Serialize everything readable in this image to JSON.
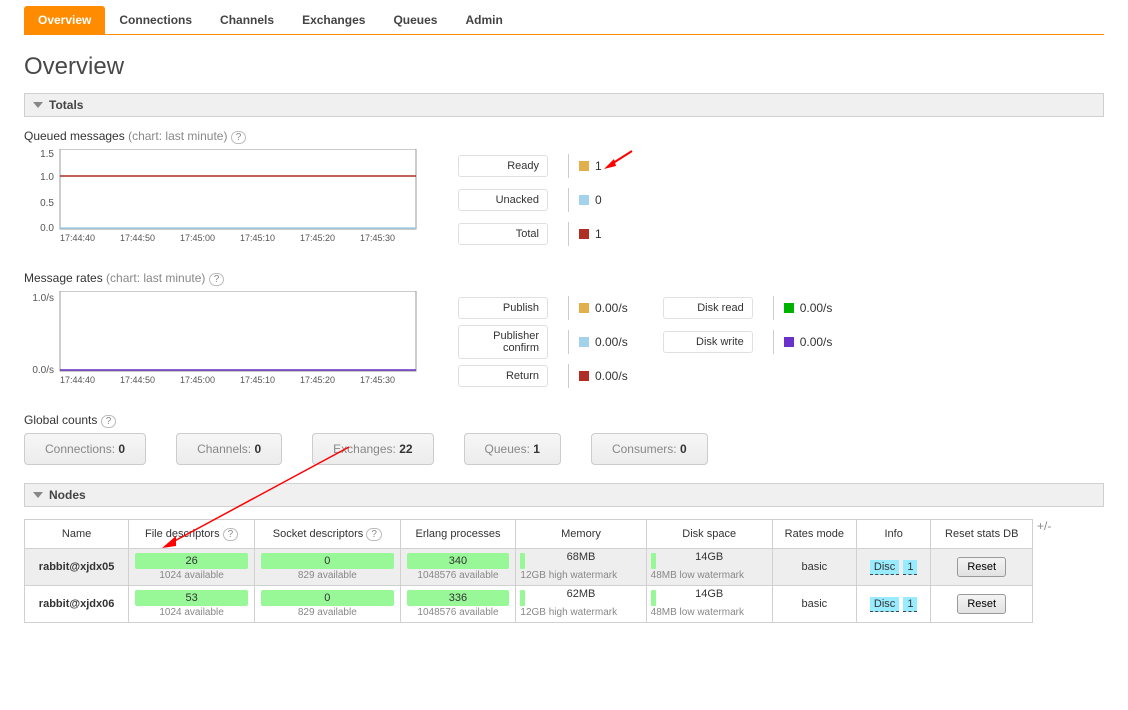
{
  "nav": {
    "tabs": [
      "Overview",
      "Connections",
      "Channels",
      "Exchanges",
      "Queues",
      "Admin"
    ],
    "selected": 0
  },
  "pageTitle": "Overview",
  "headers": {
    "totals": "Totals",
    "nodes": "Nodes"
  },
  "queued": {
    "title": "Queued messages",
    "hint": "(chart: last minute)",
    "help": "?",
    "legend": [
      {
        "label": "Ready",
        "color": "#e1af4b",
        "value": "1"
      },
      {
        "label": "Unacked",
        "color": "#a4d1ec",
        "value": "0"
      },
      {
        "label": "Total",
        "color": "#af2f24",
        "value": "1"
      }
    ]
  },
  "rates": {
    "title": "Message rates",
    "hint": "(chart: last minute)",
    "help": "?",
    "col1": [
      {
        "label": "Publish",
        "color": "#e1af4b",
        "value": "0.00/s"
      },
      {
        "label": "Publisher confirm",
        "color": "#a4d1ec",
        "value": "0.00/s"
      },
      {
        "label": "Return",
        "color": "#af2f24",
        "value": "0.00/s"
      }
    ],
    "col2": [
      {
        "label": "Disk read",
        "color": "#00b300",
        "value": "0.00/s"
      },
      {
        "label": "Disk write",
        "color": "#6a32c9",
        "value": "0.00/s"
      }
    ]
  },
  "globalCounts": {
    "title": "Global counts",
    "help": "?",
    "items": [
      {
        "label": "Connections:",
        "value": "0"
      },
      {
        "label": "Channels:",
        "value": "0"
      },
      {
        "label": "Exchanges:",
        "value": "22"
      },
      {
        "label": "Queues:",
        "value": "1"
      },
      {
        "label": "Consumers:",
        "value": "0"
      }
    ]
  },
  "nodesTable": {
    "cols": [
      "Name",
      "File descriptors",
      "Socket descriptors",
      "Erlang processes",
      "Memory",
      "Disk space",
      "Rates mode",
      "Info",
      "Reset stats DB"
    ],
    "help": "?",
    "plusminus": "+/-",
    "rows": [
      {
        "name": "rabbit@xjdx05",
        "fd": {
          "v": "26",
          "s": "1024 available"
        },
        "sd": {
          "v": "0",
          "s": "829 available"
        },
        "ep": {
          "v": "340",
          "s": "1048576 available"
        },
        "mem": {
          "v": "68MB",
          "s": "12GB high watermark"
        },
        "disk": {
          "v": "14GB",
          "s": "48MB low watermark"
        },
        "ratesMode": "basic",
        "infoTags": [
          "Disc",
          "1"
        ],
        "reset": "Reset"
      },
      {
        "name": "rabbit@xjdx06",
        "fd": {
          "v": "53",
          "s": "1024 available"
        },
        "sd": {
          "v": "0",
          "s": "829 available"
        },
        "ep": {
          "v": "336",
          "s": "1048576 available"
        },
        "mem": {
          "v": "62MB",
          "s": "12GB high watermark"
        },
        "disk": {
          "v": "14GB",
          "s": "48MB low watermark"
        },
        "ratesMode": "basic",
        "infoTags": [
          "Disc",
          "1"
        ],
        "reset": "Reset"
      }
    ]
  },
  "chart_data": [
    {
      "type": "line",
      "title": "Queued messages (last minute)",
      "x": [
        "17:44:40",
        "17:44:50",
        "17:45:00",
        "17:45:10",
        "17:45:20",
        "17:45:30"
      ],
      "y_ticks": [
        0.0,
        0.5,
        1.0,
        1.5
      ],
      "series": [
        {
          "name": "Ready",
          "color": "#e1af4b",
          "values": [
            1,
            1,
            1,
            1,
            1,
            1
          ]
        },
        {
          "name": "Unacked",
          "color": "#a4d1ec",
          "values": [
            0,
            0,
            0,
            0,
            0,
            0
          ]
        },
        {
          "name": "Total",
          "color": "#af2f24",
          "values": [
            1,
            1,
            1,
            1,
            1,
            1
          ]
        }
      ],
      "ylim": [
        0,
        1.5
      ]
    },
    {
      "type": "line",
      "title": "Message rates (last minute)",
      "x": [
        "17:44:40",
        "17:44:50",
        "17:45:00",
        "17:45:10",
        "17:45:20",
        "17:45:30"
      ],
      "y_ticks": [
        "0.0/s",
        "1.0/s"
      ],
      "series": [
        {
          "name": "Publish",
          "color": "#e1af4b",
          "values": [
            0,
            0,
            0,
            0,
            0,
            0
          ]
        },
        {
          "name": "Publisher confirm",
          "color": "#a4d1ec",
          "values": [
            0,
            0,
            0,
            0,
            0,
            0
          ]
        },
        {
          "name": "Return",
          "color": "#af2f24",
          "values": [
            0,
            0,
            0,
            0,
            0,
            0
          ]
        },
        {
          "name": "Disk read",
          "color": "#00b300",
          "values": [
            0,
            0,
            0,
            0,
            0,
            0
          ]
        },
        {
          "name": "Disk write",
          "color": "#6a32c9",
          "values": [
            0,
            0,
            0,
            0,
            0,
            0
          ]
        }
      ],
      "ylim": [
        0,
        1
      ]
    }
  ]
}
